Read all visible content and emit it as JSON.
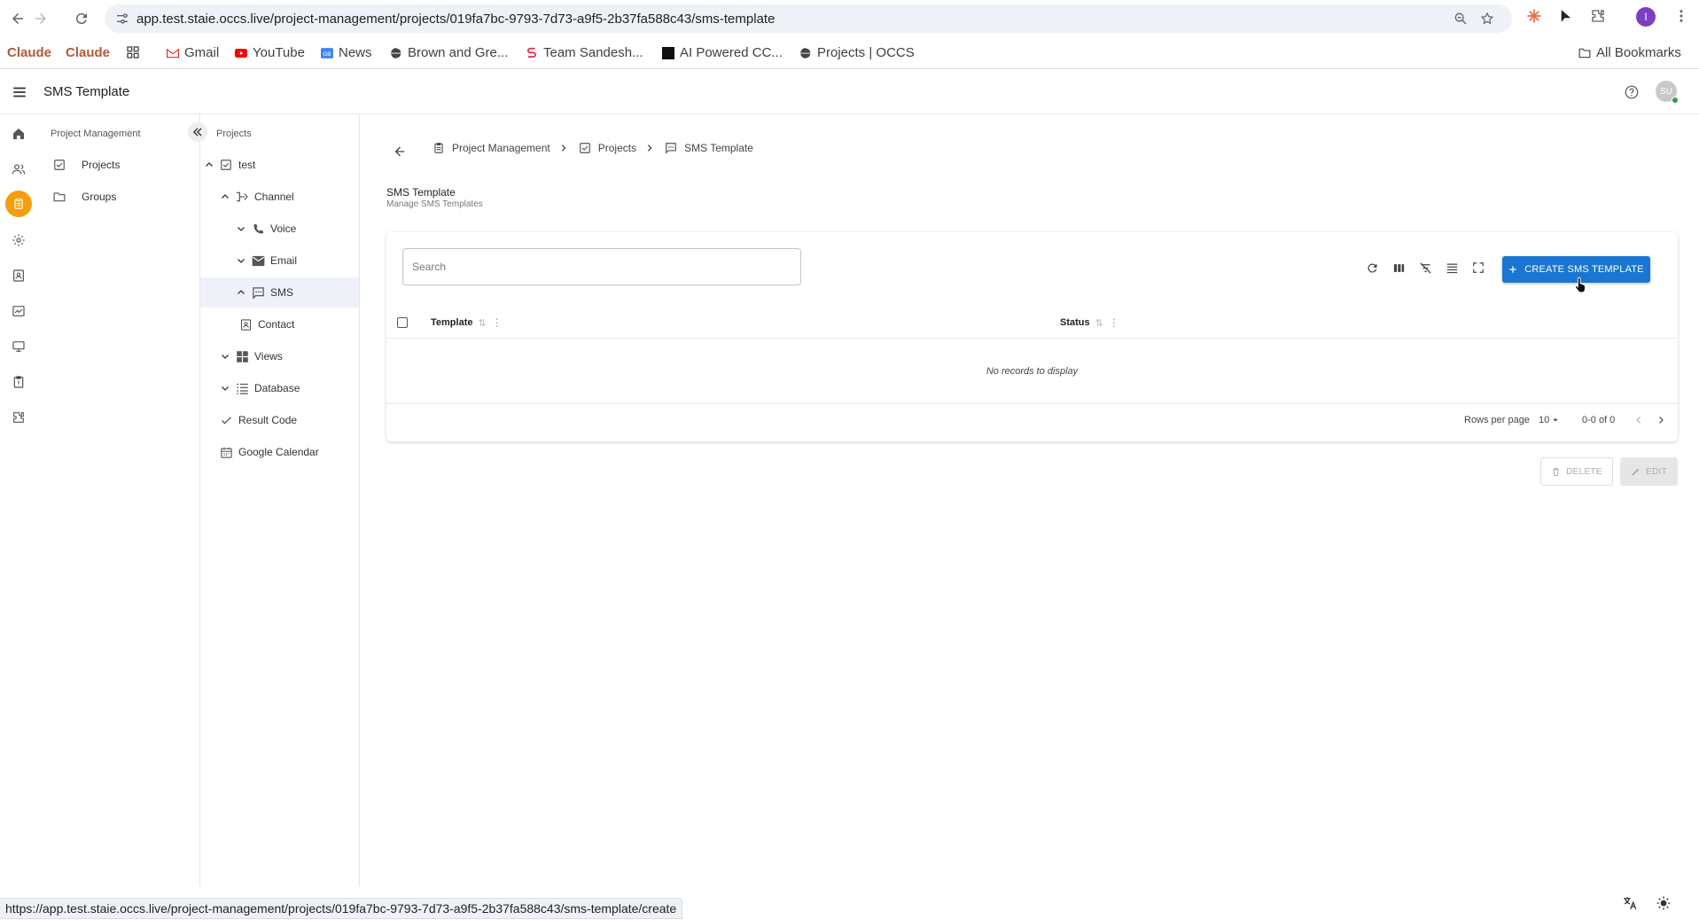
{
  "browser": {
    "url": "app.test.staie.occs.live/project-management/projects/019fa7bc-9793-7d73-a9f5-2b37fa588c43/sms-template",
    "status_url": "https://app.test.staie.occs.live/project-management/projects/019fa7bc-9793-7d73-a9f5-2b37fa588c43/sms-template/create",
    "profile_initial": "I",
    "bookmarks": [
      {
        "label": "Claude"
      },
      {
        "label": "Claude"
      },
      {
        "label": "Gmail"
      },
      {
        "label": "YouTube"
      },
      {
        "label": "News"
      },
      {
        "label": "Brown and Gre..."
      },
      {
        "label": "Team Sandesh..."
      },
      {
        "label": "AI Powered CC..."
      },
      {
        "label": "Projects | OCCS"
      }
    ],
    "all_bookmarks": "All Bookmarks"
  },
  "app": {
    "title": "SMS Template",
    "avatar_initials": "SU"
  },
  "pm_panel": {
    "heading": "Project Management",
    "items": [
      {
        "label": "Projects"
      },
      {
        "label": "Groups"
      }
    ]
  },
  "tree": {
    "heading": "Projects",
    "items": [
      {
        "label": "test"
      },
      {
        "label": "Channel"
      },
      {
        "label": "Voice"
      },
      {
        "label": "Email"
      },
      {
        "label": "SMS"
      },
      {
        "label": "Contact"
      },
      {
        "label": "Views"
      },
      {
        "label": "Database"
      },
      {
        "label": "Result Code"
      },
      {
        "label": "Google Calendar"
      }
    ]
  },
  "breadcrumb": [
    "Project Management",
    "Projects",
    "SMS Template"
  ],
  "page": {
    "title": "SMS Template",
    "subtitle": "Manage SMS Templates"
  },
  "table": {
    "search_placeholder": "Search",
    "create_label": "CREATE SMS TEMPLATE",
    "columns": [
      "Template",
      "Status"
    ],
    "empty_text": "No records to display",
    "rows_per_page_label": "Rows per page",
    "rows_per_page": "10",
    "range": "0-0 of 0"
  },
  "actions": {
    "delete": "DELETE",
    "edit": "EDIT"
  },
  "colors": {
    "accent": "#1976d2",
    "rail_active": "#f59e0b"
  }
}
